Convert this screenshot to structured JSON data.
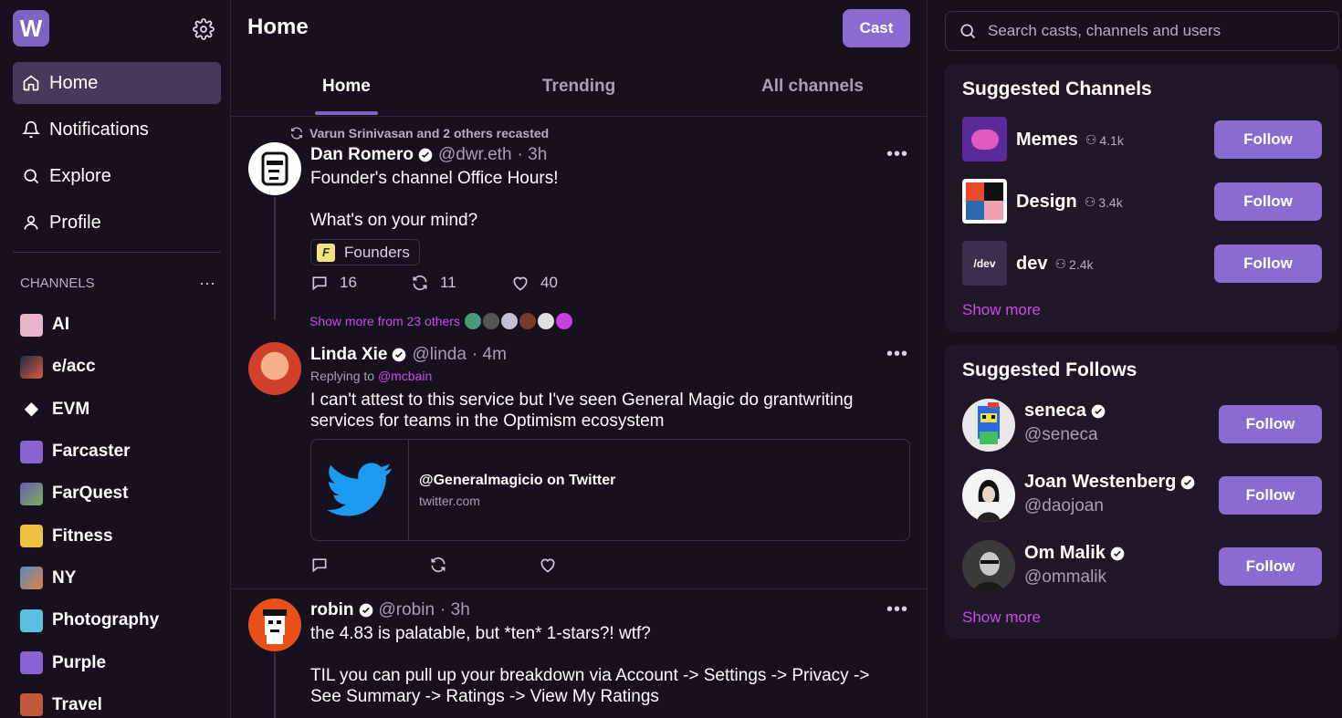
{
  "sidebar": {
    "logo": "W",
    "nav": [
      {
        "label": "Home",
        "icon": "home-icon",
        "active": true
      },
      {
        "label": "Notifications",
        "icon": "bell-icon"
      },
      {
        "label": "Explore",
        "icon": "search-icon"
      },
      {
        "label": "Profile",
        "icon": "user-icon"
      }
    ],
    "channels_header": "CHANNELS",
    "channels": [
      {
        "label": "AI",
        "color": "#e8b4c8"
      },
      {
        "label": "e/acc",
        "color": "#4a7fa8"
      },
      {
        "label": "EVM",
        "color": "#2a2a2a"
      },
      {
        "label": "Farcaster",
        "color": "#8a63d2"
      },
      {
        "label": "FarQuest",
        "color": "#7a9c5a"
      },
      {
        "label": "Fitness",
        "color": "#f0c040"
      },
      {
        "label": "NY",
        "color": "#d08040"
      },
      {
        "label": "Photography",
        "color": "#5ac0e0"
      },
      {
        "label": "Purple",
        "color": "#8a63d2"
      },
      {
        "label": "Travel",
        "color": "#c05a3a"
      }
    ]
  },
  "header": {
    "title": "Home",
    "cast_button": "Cast",
    "tabs": [
      "Home",
      "Trending",
      "All channels"
    ]
  },
  "feed": {
    "cast1": {
      "recast_note": "Varun Srinivasan and 2 others recasted",
      "name": "Dan Romero",
      "handle": "@dwr.eth",
      "time": "· 3h",
      "text1": "Founder's channel Office Hours!",
      "text2": "What's on your mind?",
      "channel_tag": "Founders",
      "replies": "16",
      "recasts": "11",
      "likes": "40",
      "show_more": "Show more from 23 others"
    },
    "cast2": {
      "name": "Linda Xie",
      "handle": "@linda",
      "time": "· 4m",
      "replying_prefix": "Replying to",
      "replying_to": "@mcbain",
      "text": "I can't attest to this service but I've seen General Magic do grantwriting services for teams in the Optimism ecosystem",
      "embed_title": "@Generalmagicio on Twitter",
      "embed_domain": "twitter.com"
    },
    "cast3": {
      "name": "robin",
      "handle": "@robin",
      "time": "· 3h",
      "text1": "the 4.83 is palatable, but *ten* 1-stars?! wtf?",
      "text2": "TIL you can pull up your breakdown via Account -> Settings -> Privacy -> See Summary -> Ratings -> View My Ratings"
    }
  },
  "search": {
    "placeholder": "Search casts, channels and users"
  },
  "suggested_channels": {
    "title": "Suggested Channels",
    "items": [
      {
        "name": "Memes",
        "count": "4.1k",
        "follow": "Follow"
      },
      {
        "name": "Design",
        "count": "3.4k",
        "follow": "Follow"
      },
      {
        "name": "dev",
        "count": "2.4k",
        "follow": "Follow",
        "icon_text": "/dev"
      }
    ],
    "show_more": "Show more"
  },
  "suggested_follows": {
    "title": "Suggested Follows",
    "items": [
      {
        "name": "seneca",
        "handle": "@seneca",
        "follow": "Follow"
      },
      {
        "name": "Joan Westenberg",
        "handle": "@daojoan",
        "follow": "Follow"
      },
      {
        "name": "Om Malik",
        "handle": "@ommalik",
        "follow": "Follow"
      }
    ],
    "show_more": "Show more"
  },
  "colors": {
    "accent": "#8a6bd1",
    "background": "#17101f",
    "panel": "#201829",
    "link": "#c84fe0"
  }
}
